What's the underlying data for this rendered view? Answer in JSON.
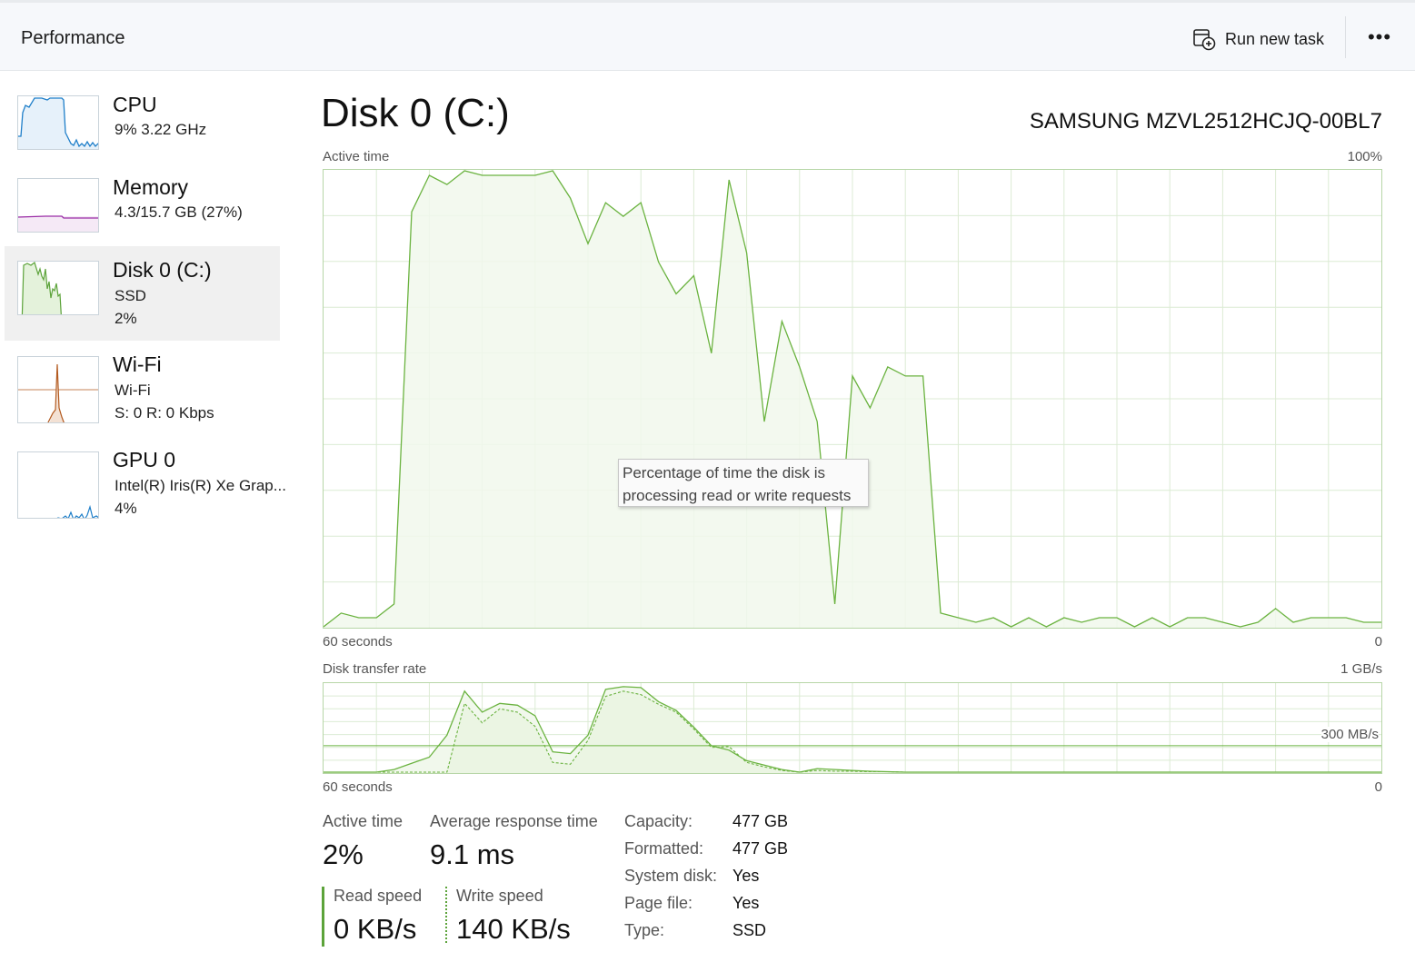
{
  "header": {
    "title": "Performance",
    "run_new_task": "Run new task",
    "more": "•••"
  },
  "sidebar": {
    "items": [
      {
        "name": "CPU",
        "sub1": "9%  3.22 GHz",
        "sub2": "",
        "icon": "cpu-graph"
      },
      {
        "name": "Memory",
        "sub1": "4.3/15.7 GB (27%)",
        "sub2": "",
        "icon": "memory-graph"
      },
      {
        "name": "Disk 0 (C:)",
        "sub1": "SSD",
        "sub2": "2%",
        "icon": "disk-graph",
        "selected": true
      },
      {
        "name": "Wi-Fi",
        "sub1": "Wi-Fi",
        "sub2": "S: 0  R: 0 Kbps",
        "icon": "wifi-graph"
      },
      {
        "name": "GPU 0",
        "sub1": "Intel(R) Iris(R) Xe Grap...",
        "sub2": "4%",
        "icon": "gpu-graph"
      }
    ]
  },
  "main": {
    "title": "Disk 0 (C:)",
    "model": "SAMSUNG MZVL2512HCJQ-00BL7",
    "active_graph": {
      "label": "Active time",
      "max_label": "100%",
      "x_left": "60 seconds",
      "x_right": "0",
      "tooltip_line1": "Percentage of time the disk is",
      "tooltip_line2": "processing read or write requests",
      "values": [
        0,
        3,
        2,
        2,
        5,
        91,
        99,
        97,
        100,
        99,
        99,
        99,
        99,
        100,
        94,
        84,
        93,
        90,
        93,
        80,
        73,
        77,
        60,
        98,
        82,
        45,
        67,
        57,
        45,
        5,
        55,
        48,
        57,
        55,
        55,
        3,
        2,
        1,
        2,
        0,
        2,
        0,
        2,
        1,
        2,
        2,
        0,
        2,
        0,
        2,
        2,
        1,
        0,
        1,
        4,
        1,
        2,
        2,
        2,
        1,
        1
      ]
    },
    "transfer_graph": {
      "label": "Disk transfer rate",
      "max_label": "1 GB/s",
      "ref_label": "300 MB/s",
      "ref_value": 300,
      "max_value": 1000,
      "x_left": "60 seconds",
      "x_right": "0",
      "read_values": [
        0,
        0,
        0,
        0,
        30,
        100,
        170,
        420,
        920,
        680,
        780,
        760,
        640,
        230,
        210,
        420,
        940,
        970,
        960,
        800,
        700,
        510,
        300,
        250,
        130,
        80,
        30,
        0,
        40,
        30,
        20,
        10,
        5,
        0,
        0,
        0,
        0,
        0,
        0,
        0,
        0,
        0,
        0,
        0,
        0,
        0,
        0,
        0,
        0,
        0,
        0,
        0,
        0,
        0,
        0,
        0,
        0,
        0,
        0,
        0,
        0
      ],
      "write_values": [
        0,
        0,
        0,
        0,
        0,
        0,
        0,
        0,
        780,
        560,
        720,
        680,
        520,
        110,
        90,
        360,
        860,
        920,
        880,
        770,
        680,
        490,
        280,
        290,
        110,
        60,
        20,
        0,
        20,
        10,
        10,
        5,
        5,
        0,
        0,
        0,
        0,
        0,
        0,
        0,
        0,
        0,
        0,
        0,
        0,
        0,
        0,
        0,
        0,
        0,
        0,
        0,
        0,
        0,
        0,
        0,
        0,
        0,
        0,
        0,
        0
      ]
    }
  },
  "stats": {
    "active_time_label": "Active time",
    "active_time_value": "2%",
    "avg_response_label": "Average response time",
    "avg_response_value": "9.1 ms",
    "read_speed_label": "Read speed",
    "read_speed_value": "0 KB/s",
    "write_speed_label": "Write speed",
    "write_speed_value": "140 KB/s",
    "properties": [
      {
        "key": "Capacity:",
        "value": "477 GB"
      },
      {
        "key": "Formatted:",
        "value": "477 GB"
      },
      {
        "key": "System disk:",
        "value": "Yes"
      },
      {
        "key": "Page file:",
        "value": "Yes"
      },
      {
        "key": "Type:",
        "value": "SSD"
      }
    ]
  },
  "colors": {
    "disk_line": "#6bb340",
    "disk_fill": "#f1f8ec",
    "grid": "#dcebd4",
    "cpu_line": "#1f7fc9",
    "memory_line": "#9b2fa6",
    "wifi_line": "#b35a1f"
  }
}
